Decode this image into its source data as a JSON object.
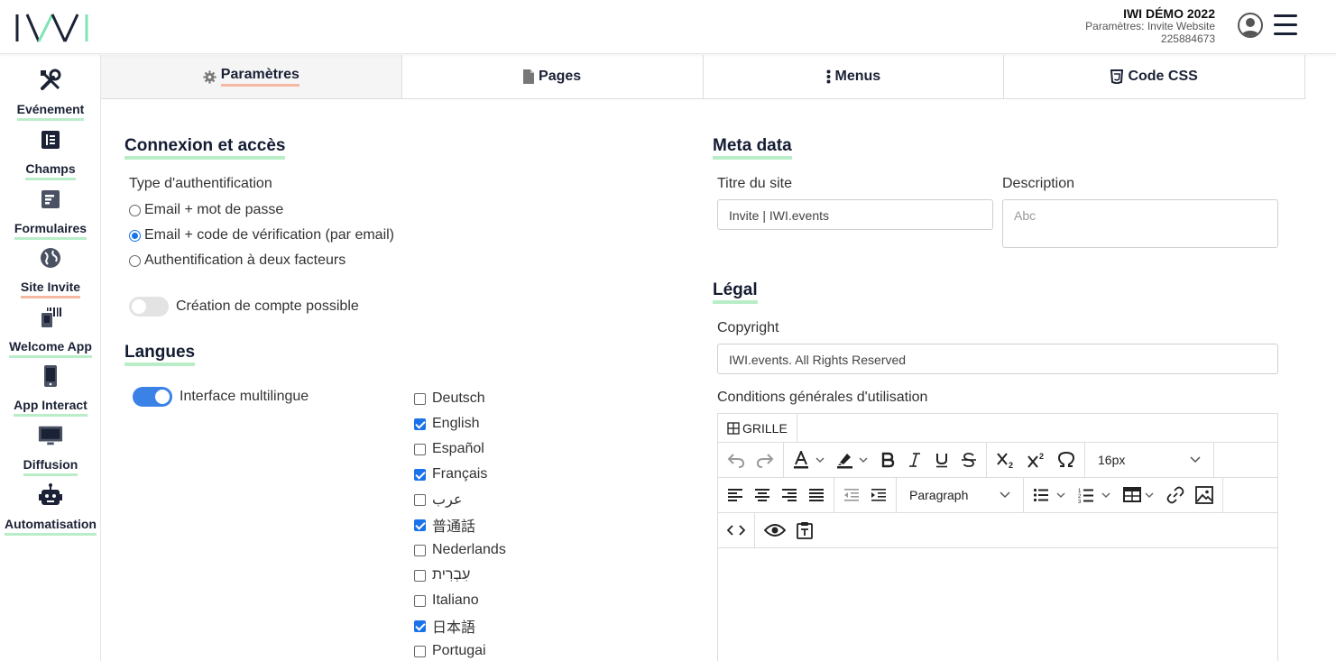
{
  "header": {
    "logo_text": "IWI",
    "event_title": "IWI DÉMO 2022",
    "event_subtitle": "Paramètres: Invite Website",
    "event_id": "225884673"
  },
  "sidebar": {
    "items": [
      {
        "label": "Evénement",
        "icon": "tools-icon",
        "active": false
      },
      {
        "label": "Champs",
        "icon": "list-icon",
        "active": false
      },
      {
        "label": "Formulaires",
        "icon": "form-icon",
        "active": false
      },
      {
        "label": "Site Invite",
        "icon": "globe-icon",
        "active": true
      },
      {
        "label": "Welcome App",
        "icon": "barcode-scanner-icon",
        "active": false
      },
      {
        "label": "App Interact",
        "icon": "phone-icon",
        "active": false
      },
      {
        "label": "Diffusion",
        "icon": "monitor-icon",
        "active": false
      },
      {
        "label": "Automatisation",
        "icon": "robot-icon",
        "active": false
      }
    ]
  },
  "tabs": [
    {
      "label": "Paramètres",
      "icon": "gear-icon",
      "active": true
    },
    {
      "label": "Pages",
      "icon": "page-icon",
      "active": false
    },
    {
      "label": "Menus",
      "icon": "vertical-dots-icon",
      "active": false
    },
    {
      "label": "Code CSS",
      "icon": "css-icon",
      "active": false
    }
  ],
  "connexion": {
    "title": "Connexion et accès",
    "auth_label": "Type d'authentification",
    "auth_options": [
      {
        "label": "Email + mot de passe",
        "checked": false
      },
      {
        "label": "Email + code de vérification (par email)",
        "checked": true
      },
      {
        "label": "Authentification à deux facteurs",
        "checked": false
      }
    ],
    "account_toggle_label": "Création de compte possible",
    "account_toggle_on": false
  },
  "langues": {
    "title": "Langues",
    "multilingual_label": "Interface multilingue",
    "multilingual_on": true,
    "languages": [
      {
        "label": "Deutsch",
        "checked": false
      },
      {
        "label": "English",
        "checked": true
      },
      {
        "label": "Español",
        "checked": false
      },
      {
        "label": "Français",
        "checked": true
      },
      {
        "label": "عرب",
        "checked": false
      },
      {
        "label": "普通話",
        "checked": true
      },
      {
        "label": "Nederlands",
        "checked": false
      },
      {
        "label": "עִבְרִית",
        "checked": false
      },
      {
        "label": "Italiano",
        "checked": false
      },
      {
        "label": "日本語",
        "checked": true
      },
      {
        "label": "Portugai",
        "checked": false
      }
    ]
  },
  "meta": {
    "title": "Meta data",
    "site_title_label": "Titre du site",
    "site_title_value": "Invite | IWI.events",
    "description_label": "Description",
    "description_placeholder": "Abc"
  },
  "legal": {
    "title": "Légal",
    "copyright_label": "Copyright",
    "copyright_value": "IWI.events. All Rights Reserved",
    "cgu_label": "Conditions générales d'utilisation"
  },
  "editor": {
    "grille_label": "GRILLE",
    "font_size": "16px",
    "block_format": "Paragraph"
  },
  "colors": {
    "accent_blue": "#3b82e6",
    "underline_green": "#b9edc8",
    "underline_orange": "#f4b9a0",
    "logo_teal": "#7fe3b5",
    "navy": "#1b2235"
  }
}
